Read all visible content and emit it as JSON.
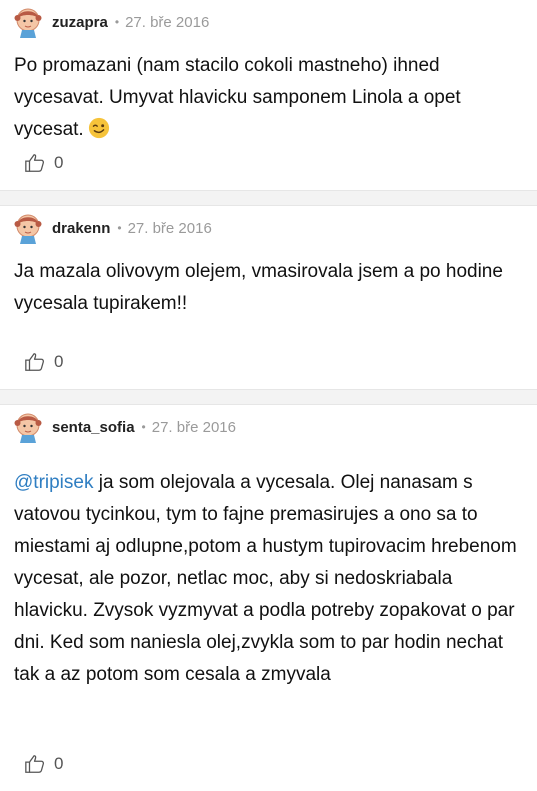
{
  "comments": [
    {
      "username": "zuzapra",
      "separator": "•",
      "date": "27. bře 2016",
      "text": "Po promazani (nam stacilo cokoli mastneho) ihned vycesavat. Umyvat hlavicku samponem Linola a opet vycesat.",
      "emoji": "winking-face",
      "likes": "0"
    },
    {
      "username": "drakenn",
      "separator": "•",
      "date": "27. bře 2016",
      "text": "Ja mazala olivovym olejem, vmasirovala jsem a po hodine vycesala tupirakem!!",
      "likes": "0"
    },
    {
      "username": "senta_sofia",
      "separator": "•",
      "date": "27. bře 2016",
      "mention": "@tripisek",
      "text": " ja som olejovala a vycesala. Olej nanasam s vatovou tycinkou, tym to fajne premasirujes a ono sa to miestami aj odlupne,potom a hustym tupirovacim hrebenom vycesat, ale pozor, netlac moc, aby si nedoskriabala hlavicku. Zvysok vyzmyvat a podla potreby zopakovat o par dni. Ked som naniesla olej,zvykla som to par hodin nechat tak a az potom som cesala a zmyvala",
      "likes": "0"
    }
  ],
  "colors": {
    "mention": "#2f7ec2",
    "meta": "#9a9a9a",
    "divider": "#f3f3f3",
    "emoji": "#f6c33a"
  },
  "icons": {
    "avatar": "girl-avatar-icon",
    "like": "thumbs-up-icon",
    "emoji": "winking-face-icon"
  }
}
